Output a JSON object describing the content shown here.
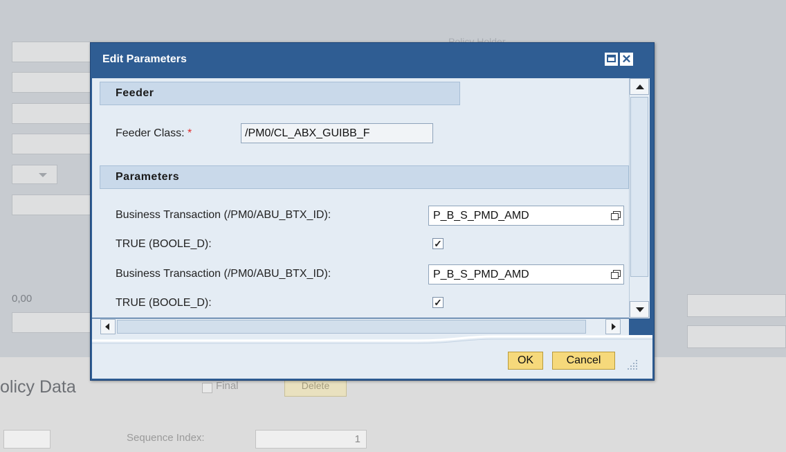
{
  "background": {
    "value_text": "0,00",
    "faded_label": "Policy Holder",
    "section_title": "olicy Data",
    "final_label": "Final",
    "delete_label": "Delete",
    "sequence_label": "Sequence Index:",
    "sequence_value": "1"
  },
  "dialog": {
    "title": "Edit Parameters",
    "feeder": {
      "header": "Feeder",
      "class_label": "Feeder Class:",
      "required_mark": "*",
      "class_value": "/PM0/CL_ABX_GUIBB_F"
    },
    "parameters": {
      "header": "Parameters",
      "rows": [
        {
          "label": "Business Transaction (/PM0/ABU_BTX_ID):",
          "value": "P_B_S_PMD_AMD"
        },
        {
          "label": "TRUE (BOOLE_D):",
          "checked": "✓"
        },
        {
          "label": "Business Transaction (/PM0/ABU_BTX_ID):",
          "value": "P_B_S_PMD_AMD"
        },
        {
          "label": "TRUE (BOOLE_D):",
          "checked": "✓"
        }
      ]
    },
    "buttons": {
      "ok": "OK",
      "cancel": "Cancel",
      "close": "✕"
    }
  },
  "colors": {
    "titlebar": "#2f5d93",
    "content_bg": "#e4ecf4",
    "section_header": "#c9d9ea",
    "button": "#f6d97b",
    "required": "#e12a2a"
  },
  "icons": [
    "maximize-icon",
    "close-icon",
    "value-help-icon",
    "scroll-up-icon",
    "scroll-down-icon",
    "scroll-left-icon",
    "scroll-right-icon",
    "resize-grip-icon"
  ]
}
